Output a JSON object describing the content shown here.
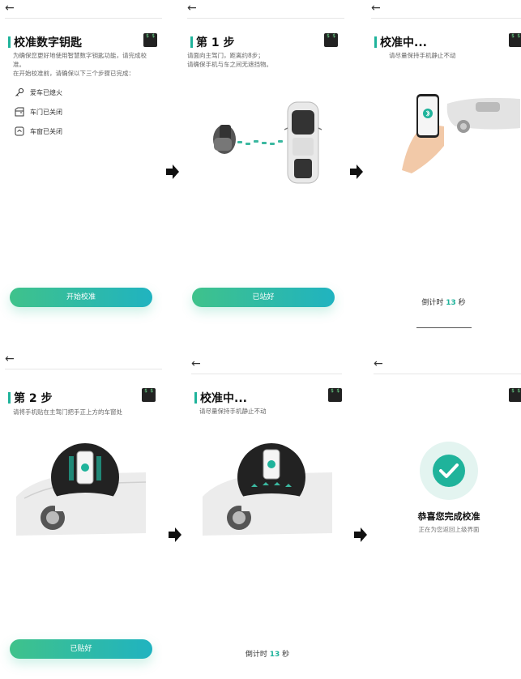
{
  "common": {
    "back_icon": "arrow-left-icon",
    "chip_text": "$ $",
    "countdown_prefix": "倒计时",
    "countdown_suffix": "秒"
  },
  "screen1": {
    "title": "校准数字钥匙",
    "desc_line1": "为确保您更好地使用智慧数字钥匙功能，请完成校准。",
    "desc_line2": "在开始校准前，请确保以下三个步骤已完成：",
    "items": [
      {
        "icon": "key-icon",
        "label": "爱车已熄火"
      },
      {
        "icon": "car-door-icon",
        "label": "车门已关闭"
      },
      {
        "icon": "car-window-icon",
        "label": "车窗已关闭"
      }
    ],
    "button": "开始校准"
  },
  "screen2": {
    "title": "第 1 步",
    "desc_line1": "请面向主驾门，距离约8步；",
    "desc_line2": "请确保手机与车之间无遮挡物。",
    "button": "已站好"
  },
  "screen3": {
    "title": "校准中...",
    "desc": "请尽量保持手机静止不动",
    "countdown": "13"
  },
  "screen4": {
    "title": "第 2 步",
    "desc": "请将手机贴在主驾门把手正上方的车窗处",
    "button": "已贴好"
  },
  "screen5": {
    "title": "校准中...",
    "desc": "请尽量保持手机静止不动",
    "countdown": "13"
  },
  "screen6": {
    "title": "恭喜您完成校准",
    "desc": "正在为您返回上级界面"
  },
  "colors": {
    "accent": "#1fb39b",
    "button_start": "#3fc28b",
    "button_end": "#20b3c0"
  }
}
